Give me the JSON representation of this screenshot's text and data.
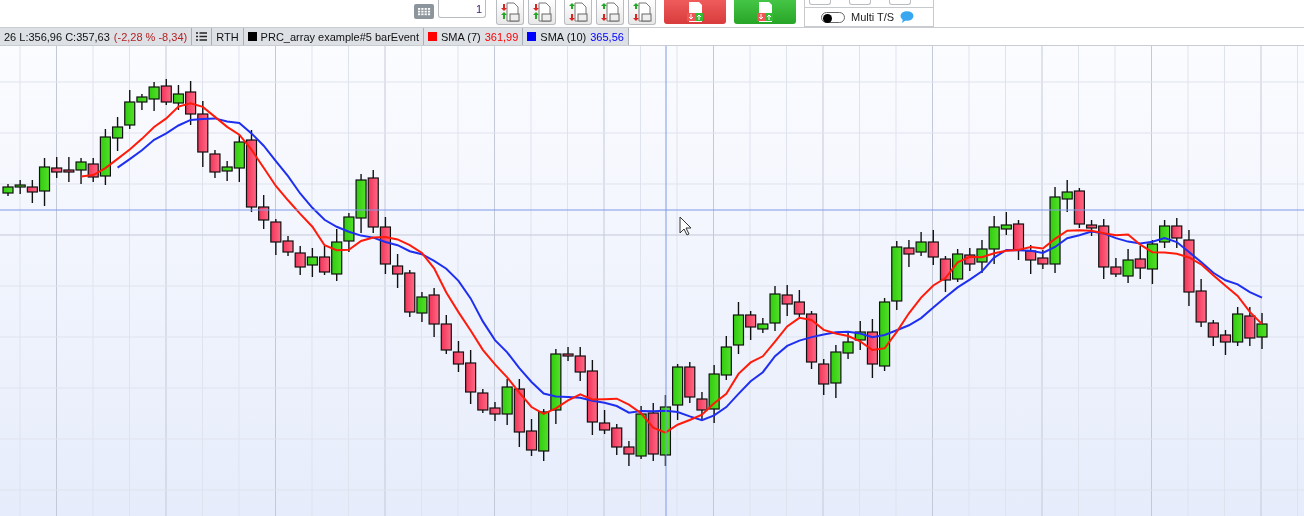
{
  "toolbar": {
    "quantity": "1",
    "toggle_on": false,
    "toggle_label": "Multi T/S"
  },
  "legend": {
    "price": "26 L:356,96 C:357,63",
    "change": "(-2,28 % -8,34)",
    "session": "RTH",
    "indicators": [
      {
        "name": "PRC_array example#5 barEvent",
        "color": "#000000"
      },
      {
        "name": "SMA (7)",
        "value": "361,99",
        "color": "#ff0000"
      },
      {
        "name": "SMA (10)",
        "value": "365,56",
        "color": "#0000ff"
      }
    ]
  }
}
